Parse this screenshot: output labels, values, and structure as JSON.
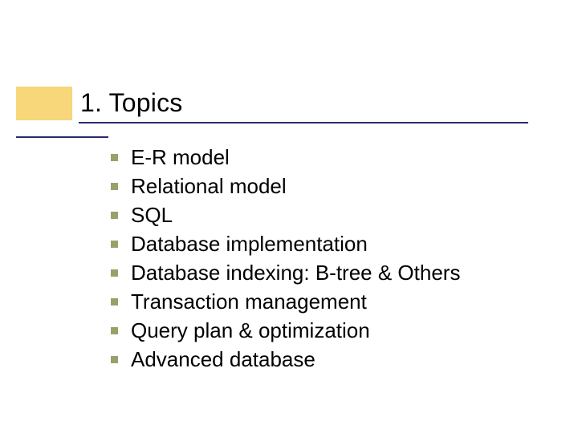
{
  "title": "1. Topics",
  "items": [
    {
      "label": "E-R model"
    },
    {
      "label": "Relational model"
    },
    {
      "label": "SQL"
    },
    {
      "label": "Database implementation"
    },
    {
      "label": "Database indexing: B-tree & Others"
    },
    {
      "label": "Transaction management"
    },
    {
      "label": "Query plan & optimization"
    },
    {
      "label": "Advanced database"
    }
  ]
}
